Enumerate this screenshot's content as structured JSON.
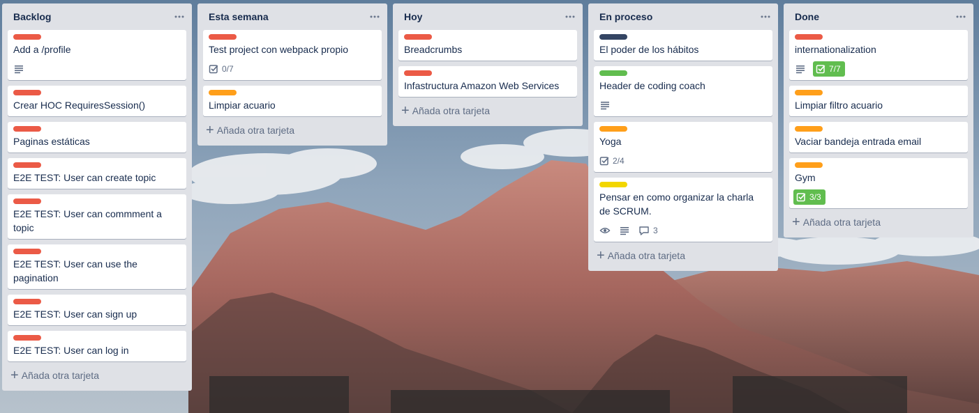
{
  "colors": {
    "label_red": "#eb5a46",
    "label_orange": "#ff9f1a",
    "label_green": "#61bd4f",
    "label_yellow": "#f2d600",
    "label_black": "#344563",
    "list_bg": "#dfe1e6",
    "badge_complete": "#61bd4f"
  },
  "add_card_label": "Añada otra tarjeta",
  "lists": [
    {
      "title": "Backlog",
      "cards": [
        {
          "label": "red",
          "title": "Add a /profile",
          "badges": [
            {
              "type": "description"
            }
          ]
        },
        {
          "label": "red",
          "title": "Crear HOC RequiresSession()",
          "badges": []
        },
        {
          "label": "red",
          "title": "Paginas estáticas",
          "badges": []
        },
        {
          "label": "red",
          "title": "E2E TEST: User can create topic",
          "badges": []
        },
        {
          "label": "red",
          "title": "E2E TEST: User can commment a topic",
          "badges": []
        },
        {
          "label": "red",
          "title": "E2E TEST: User can use the pagination",
          "badges": []
        },
        {
          "label": "red",
          "title": "E2E TEST: User can sign up",
          "badges": []
        },
        {
          "label": "red",
          "title": "E2E TEST: User can log in",
          "badges": []
        }
      ]
    },
    {
      "title": "Esta semana",
      "cards": [
        {
          "label": "red",
          "title": "Test project con webpack propio",
          "badges": [
            {
              "type": "checklist",
              "text": "0/7",
              "complete": false
            }
          ]
        },
        {
          "label": "orange",
          "title": "Limpiar acuario",
          "badges": []
        }
      ]
    },
    {
      "title": "Hoy",
      "cards": [
        {
          "label": "red",
          "title": "Breadcrumbs",
          "badges": []
        },
        {
          "label": "red",
          "title": "Infastructura Amazon Web Services",
          "badges": []
        }
      ]
    },
    {
      "title": "En proceso",
      "cards": [
        {
          "label": "black",
          "title": "El poder de los hábitos",
          "badges": []
        },
        {
          "label": "green",
          "title": "Header de coding coach",
          "badges": [
            {
              "type": "description"
            }
          ]
        },
        {
          "label": "orange",
          "title": "Yoga",
          "badges": [
            {
              "type": "checklist",
              "text": "2/4",
              "complete": false
            }
          ]
        },
        {
          "label": "yellow",
          "title": "Pensar en como organizar la charla de SCRUM.",
          "badges": [
            {
              "type": "watch"
            },
            {
              "type": "description"
            },
            {
              "type": "comments",
              "text": "3"
            }
          ]
        }
      ]
    },
    {
      "title": "Done",
      "cards": [
        {
          "label": "red",
          "title": "internationalization",
          "badges": [
            {
              "type": "description"
            },
            {
              "type": "checklist",
              "text": "7/7",
              "complete": true
            }
          ]
        },
        {
          "label": "orange",
          "title": "Limpiar filtro acuario",
          "badges": []
        },
        {
          "label": "orange",
          "title": "Vaciar bandeja entrada email",
          "badges": []
        },
        {
          "label": "orange",
          "title": "Gym",
          "badges": [
            {
              "type": "checklist",
              "text": "3/3",
              "complete": true
            }
          ]
        }
      ]
    }
  ]
}
